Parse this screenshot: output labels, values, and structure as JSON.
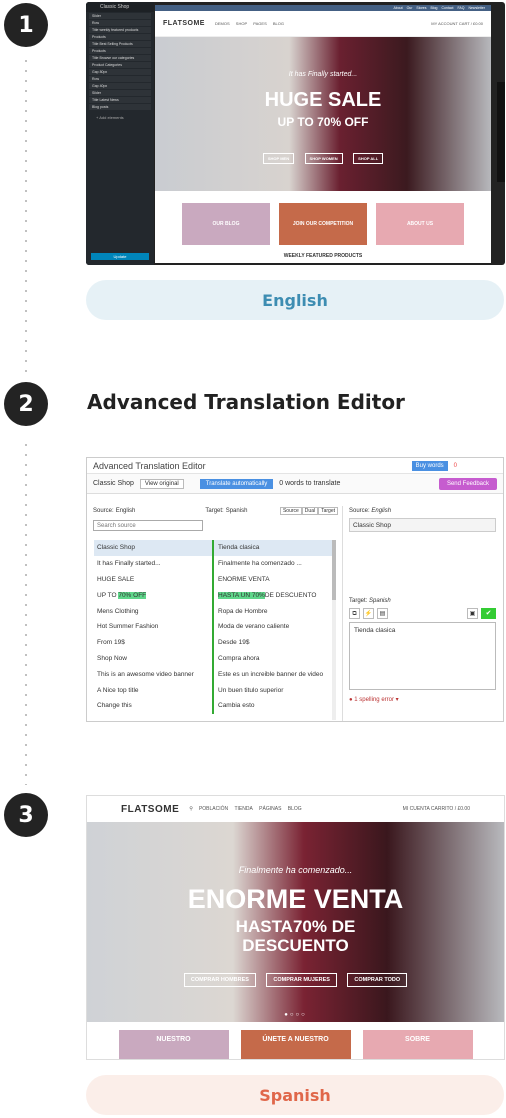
{
  "steps": [
    "1",
    "2",
    "3"
  ],
  "labels": {
    "english": "English",
    "heading": "Advanced Translation Editor",
    "spanish": "Spanish"
  },
  "colors": {
    "english_pill": "#e6f1f6",
    "english_text": "#3d8db2",
    "spanish_pill": "#fbeee9",
    "spanish_text": "#e0674a"
  },
  "shot1": {
    "sidebar_title": "Classic Shop",
    "rows": [
      "Slider",
      "Row",
      "Title  weekly featured products",
      "Products",
      "Title  Best Selling Products",
      "Products",
      "Title  Browse our categories",
      "Product Categories",
      "Gap  80px",
      "Row",
      "Gap  40px",
      "Slider",
      "Title  Latest News",
      "Blog posts"
    ],
    "add": "+ Add elements",
    "update": "Update",
    "topbar": "About  Our Stores  Blog  Contact  FAQ  Newsletter",
    "logo": "FLATSOME",
    "nav": [
      "DEMOS",
      "SHOP",
      "PAGES",
      "BLOG"
    ],
    "account": "MY ACCOUNT   CART / £0.00",
    "sub": "It has Finally started...",
    "big": "HUGE SALE",
    "mid": "UP TO 70% OFF",
    "buttons": [
      "SHOP MEN",
      "SHOP WOMEN",
      "SHOP ALL"
    ],
    "tiles": [
      "OUR BLOG",
      "JOIN OUR COMPETITION",
      "ABOUT US"
    ],
    "weekly": "WEEKLY FEATURED PRODUCTS"
  },
  "shot2": {
    "title": "Advanced Translation Editor",
    "buy": "Buy words",
    "cart": "0",
    "doc": "Classic Shop",
    "view": "View original",
    "auto": "Translate automatically",
    "words": "0 words to translate",
    "feedback": "Send Feedback",
    "src_lbl": "Source:",
    "src_lang": "English",
    "tgt_lbl": "Target:",
    "tgt_lang": "Spanish",
    "modes": [
      "Source",
      "Dual",
      "Target"
    ],
    "search": "Search source",
    "rows": [
      {
        "a": "Classic Shop",
        "b": "Tienda clasica"
      },
      {
        "a": "It has Finally started...",
        "b": "Finalmente ha comenzado ..."
      },
      {
        "a": "HUGE SALE",
        "b": "ENORME VENTA"
      },
      {
        "a1": "UP TO ",
        "ah": "70% OFF",
        "b1": "HASTA UN 70%",
        "b2": " DE DESCUENTO"
      },
      {
        "a": "Mens Clothing",
        "b": "Ropa de Hombre"
      },
      {
        "a": "Hot Summer Fashion",
        "b": "Moda de verano caliente"
      },
      {
        "a": "From 19$",
        "b": "Desde 19$"
      },
      {
        "a": "Shop Now",
        "b": "Compra ahora"
      },
      {
        "a": "This is an awesome video banner",
        "b": "Este es un increible banner de video"
      },
      {
        "a": "A Nice top title",
        "b": "Un buen titulo superior"
      },
      {
        "a": "Change this",
        "b": "Cambia esto"
      }
    ],
    "rp_src_lbl": "Source:",
    "rp_src_lang": "English",
    "rp_src_text": "Classic Shop",
    "rp_tgt_lbl": "Target:",
    "rp_tgt_lang": "Spanish",
    "rp_tgt_text": "Tienda clasica",
    "errors": "1 spelling error"
  },
  "shot3": {
    "logo": "FLATSOME",
    "nav": [
      "POBLACIÓN",
      "TIENDA",
      "PÁGINAS",
      "BLOG"
    ],
    "account": "MI CUENTA      CARRITO / £0.00",
    "sub": "Finalmente ha comenzado...",
    "big": "ENORME VENTA",
    "mid1": "HASTA70% DE",
    "mid2": "DESCUENTO",
    "buttons": [
      "COMPRAR HOMBRES",
      "COMPRAR MUJERES",
      "COMPRAR TODO"
    ],
    "tiles": [
      "NUESTRO",
      "ÚNETE A NUESTRO",
      "SOBRE"
    ]
  }
}
